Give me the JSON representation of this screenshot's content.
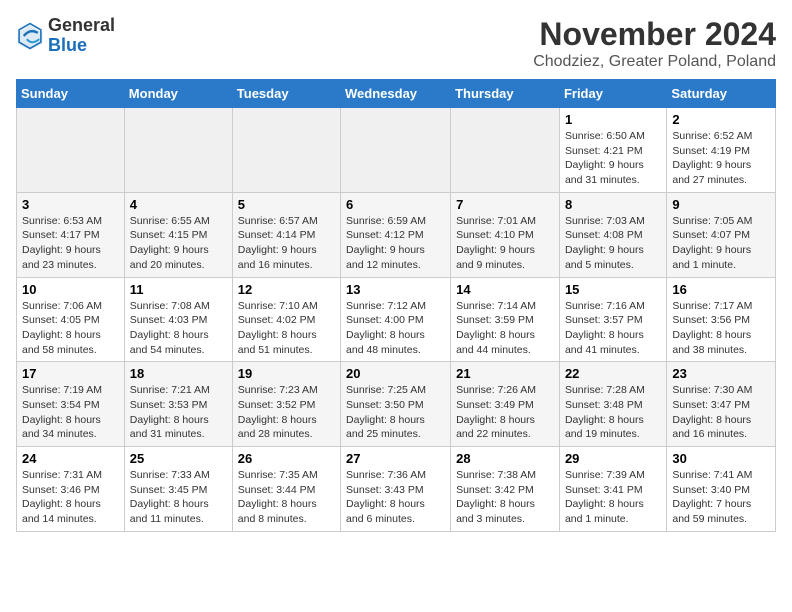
{
  "header": {
    "logo_line1": "General",
    "logo_line2": "Blue",
    "title": "November 2024",
    "subtitle": "Chodziez, Greater Poland, Poland"
  },
  "columns": [
    "Sunday",
    "Monday",
    "Tuesday",
    "Wednesday",
    "Thursday",
    "Friday",
    "Saturday"
  ],
  "weeks": [
    [
      {
        "day": "",
        "info": ""
      },
      {
        "day": "",
        "info": ""
      },
      {
        "day": "",
        "info": ""
      },
      {
        "day": "",
        "info": ""
      },
      {
        "day": "",
        "info": ""
      },
      {
        "day": "1",
        "info": "Sunrise: 6:50 AM\nSunset: 4:21 PM\nDaylight: 9 hours and 31 minutes."
      },
      {
        "day": "2",
        "info": "Sunrise: 6:52 AM\nSunset: 4:19 PM\nDaylight: 9 hours and 27 minutes."
      }
    ],
    [
      {
        "day": "3",
        "info": "Sunrise: 6:53 AM\nSunset: 4:17 PM\nDaylight: 9 hours and 23 minutes."
      },
      {
        "day": "4",
        "info": "Sunrise: 6:55 AM\nSunset: 4:15 PM\nDaylight: 9 hours and 20 minutes."
      },
      {
        "day": "5",
        "info": "Sunrise: 6:57 AM\nSunset: 4:14 PM\nDaylight: 9 hours and 16 minutes."
      },
      {
        "day": "6",
        "info": "Sunrise: 6:59 AM\nSunset: 4:12 PM\nDaylight: 9 hours and 12 minutes."
      },
      {
        "day": "7",
        "info": "Sunrise: 7:01 AM\nSunset: 4:10 PM\nDaylight: 9 hours and 9 minutes."
      },
      {
        "day": "8",
        "info": "Sunrise: 7:03 AM\nSunset: 4:08 PM\nDaylight: 9 hours and 5 minutes."
      },
      {
        "day": "9",
        "info": "Sunrise: 7:05 AM\nSunset: 4:07 PM\nDaylight: 9 hours and 1 minute."
      }
    ],
    [
      {
        "day": "10",
        "info": "Sunrise: 7:06 AM\nSunset: 4:05 PM\nDaylight: 8 hours and 58 minutes."
      },
      {
        "day": "11",
        "info": "Sunrise: 7:08 AM\nSunset: 4:03 PM\nDaylight: 8 hours and 54 minutes."
      },
      {
        "day": "12",
        "info": "Sunrise: 7:10 AM\nSunset: 4:02 PM\nDaylight: 8 hours and 51 minutes."
      },
      {
        "day": "13",
        "info": "Sunrise: 7:12 AM\nSunset: 4:00 PM\nDaylight: 8 hours and 48 minutes."
      },
      {
        "day": "14",
        "info": "Sunrise: 7:14 AM\nSunset: 3:59 PM\nDaylight: 8 hours and 44 minutes."
      },
      {
        "day": "15",
        "info": "Sunrise: 7:16 AM\nSunset: 3:57 PM\nDaylight: 8 hours and 41 minutes."
      },
      {
        "day": "16",
        "info": "Sunrise: 7:17 AM\nSunset: 3:56 PM\nDaylight: 8 hours and 38 minutes."
      }
    ],
    [
      {
        "day": "17",
        "info": "Sunrise: 7:19 AM\nSunset: 3:54 PM\nDaylight: 8 hours and 34 minutes."
      },
      {
        "day": "18",
        "info": "Sunrise: 7:21 AM\nSunset: 3:53 PM\nDaylight: 8 hours and 31 minutes."
      },
      {
        "day": "19",
        "info": "Sunrise: 7:23 AM\nSunset: 3:52 PM\nDaylight: 8 hours and 28 minutes."
      },
      {
        "day": "20",
        "info": "Sunrise: 7:25 AM\nSunset: 3:50 PM\nDaylight: 8 hours and 25 minutes."
      },
      {
        "day": "21",
        "info": "Sunrise: 7:26 AM\nSunset: 3:49 PM\nDaylight: 8 hours and 22 minutes."
      },
      {
        "day": "22",
        "info": "Sunrise: 7:28 AM\nSunset: 3:48 PM\nDaylight: 8 hours and 19 minutes."
      },
      {
        "day": "23",
        "info": "Sunrise: 7:30 AM\nSunset: 3:47 PM\nDaylight: 8 hours and 16 minutes."
      }
    ],
    [
      {
        "day": "24",
        "info": "Sunrise: 7:31 AM\nSunset: 3:46 PM\nDaylight: 8 hours and 14 minutes."
      },
      {
        "day": "25",
        "info": "Sunrise: 7:33 AM\nSunset: 3:45 PM\nDaylight: 8 hours and 11 minutes."
      },
      {
        "day": "26",
        "info": "Sunrise: 7:35 AM\nSunset: 3:44 PM\nDaylight: 8 hours and 8 minutes."
      },
      {
        "day": "27",
        "info": "Sunrise: 7:36 AM\nSunset: 3:43 PM\nDaylight: 8 hours and 6 minutes."
      },
      {
        "day": "28",
        "info": "Sunrise: 7:38 AM\nSunset: 3:42 PM\nDaylight: 8 hours and 3 minutes."
      },
      {
        "day": "29",
        "info": "Sunrise: 7:39 AM\nSunset: 3:41 PM\nDaylight: 8 hours and 1 minute."
      },
      {
        "day": "30",
        "info": "Sunrise: 7:41 AM\nSunset: 3:40 PM\nDaylight: 7 hours and 59 minutes."
      }
    ]
  ]
}
